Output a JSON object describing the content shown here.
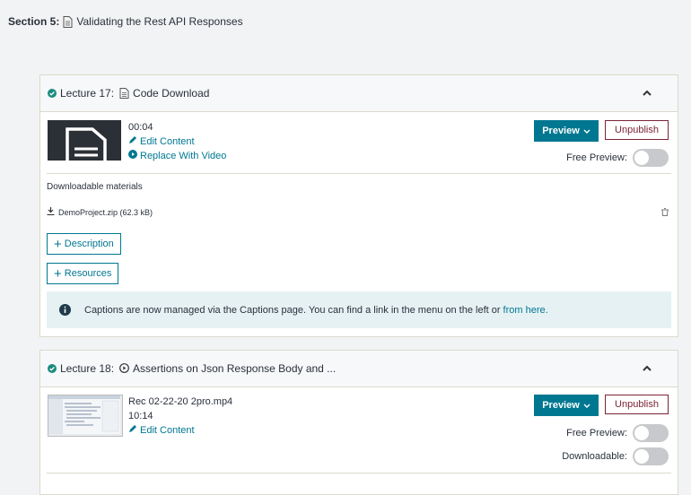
{
  "section": {
    "label": "Section 5:",
    "title": "Validating the Rest API Responses"
  },
  "lectures": [
    {
      "number": "Lecture 17:",
      "title": "Code Download",
      "duration": "00:04",
      "edit_label": "Edit Content",
      "replace_label": "Replace With Video",
      "preview_label": "Preview",
      "unpublish_label": "Unpublish",
      "free_preview_label": "Free Preview:",
      "free_preview_on": false,
      "downloadable_title": "Downloadable materials",
      "file": "DemoProject.zip (62.3 kB)",
      "description_label": "Description",
      "resources_label": "Resources",
      "captions_text": "Captions are now managed via the Captions page. You can find a link in the menu on the left or",
      "captions_link": "from here."
    },
    {
      "number": "Lecture 18:",
      "title": "Assertions on Json Response Body and ...",
      "file_title": "Rec 02-22-20 2pro.mp4",
      "duration": "10:14",
      "edit_label": "Edit Content",
      "preview_label": "Preview",
      "unpublish_label": "Unpublish",
      "free_preview_label": "Free Preview:",
      "free_preview_on": false,
      "downloadable_label": "Downloadable:",
      "downloadable_on": false
    }
  ],
  "colors": {
    "accent": "#007791",
    "unpublish": "#7b2337",
    "alert_bg": "#e6f1f4",
    "check": "#1b8b7f"
  },
  "icons": {
    "section": "document-icon",
    "lecture17_type": "document-icon",
    "lecture18_type": "play-circle-icon",
    "status": "check-circle-icon",
    "collapse": "chevron-up-icon",
    "edit": "pencil-icon",
    "replace": "play-circle-icon",
    "download": "download-icon",
    "delete": "trash-icon",
    "info": "info-icon",
    "dropdown": "chevron-down-icon"
  }
}
